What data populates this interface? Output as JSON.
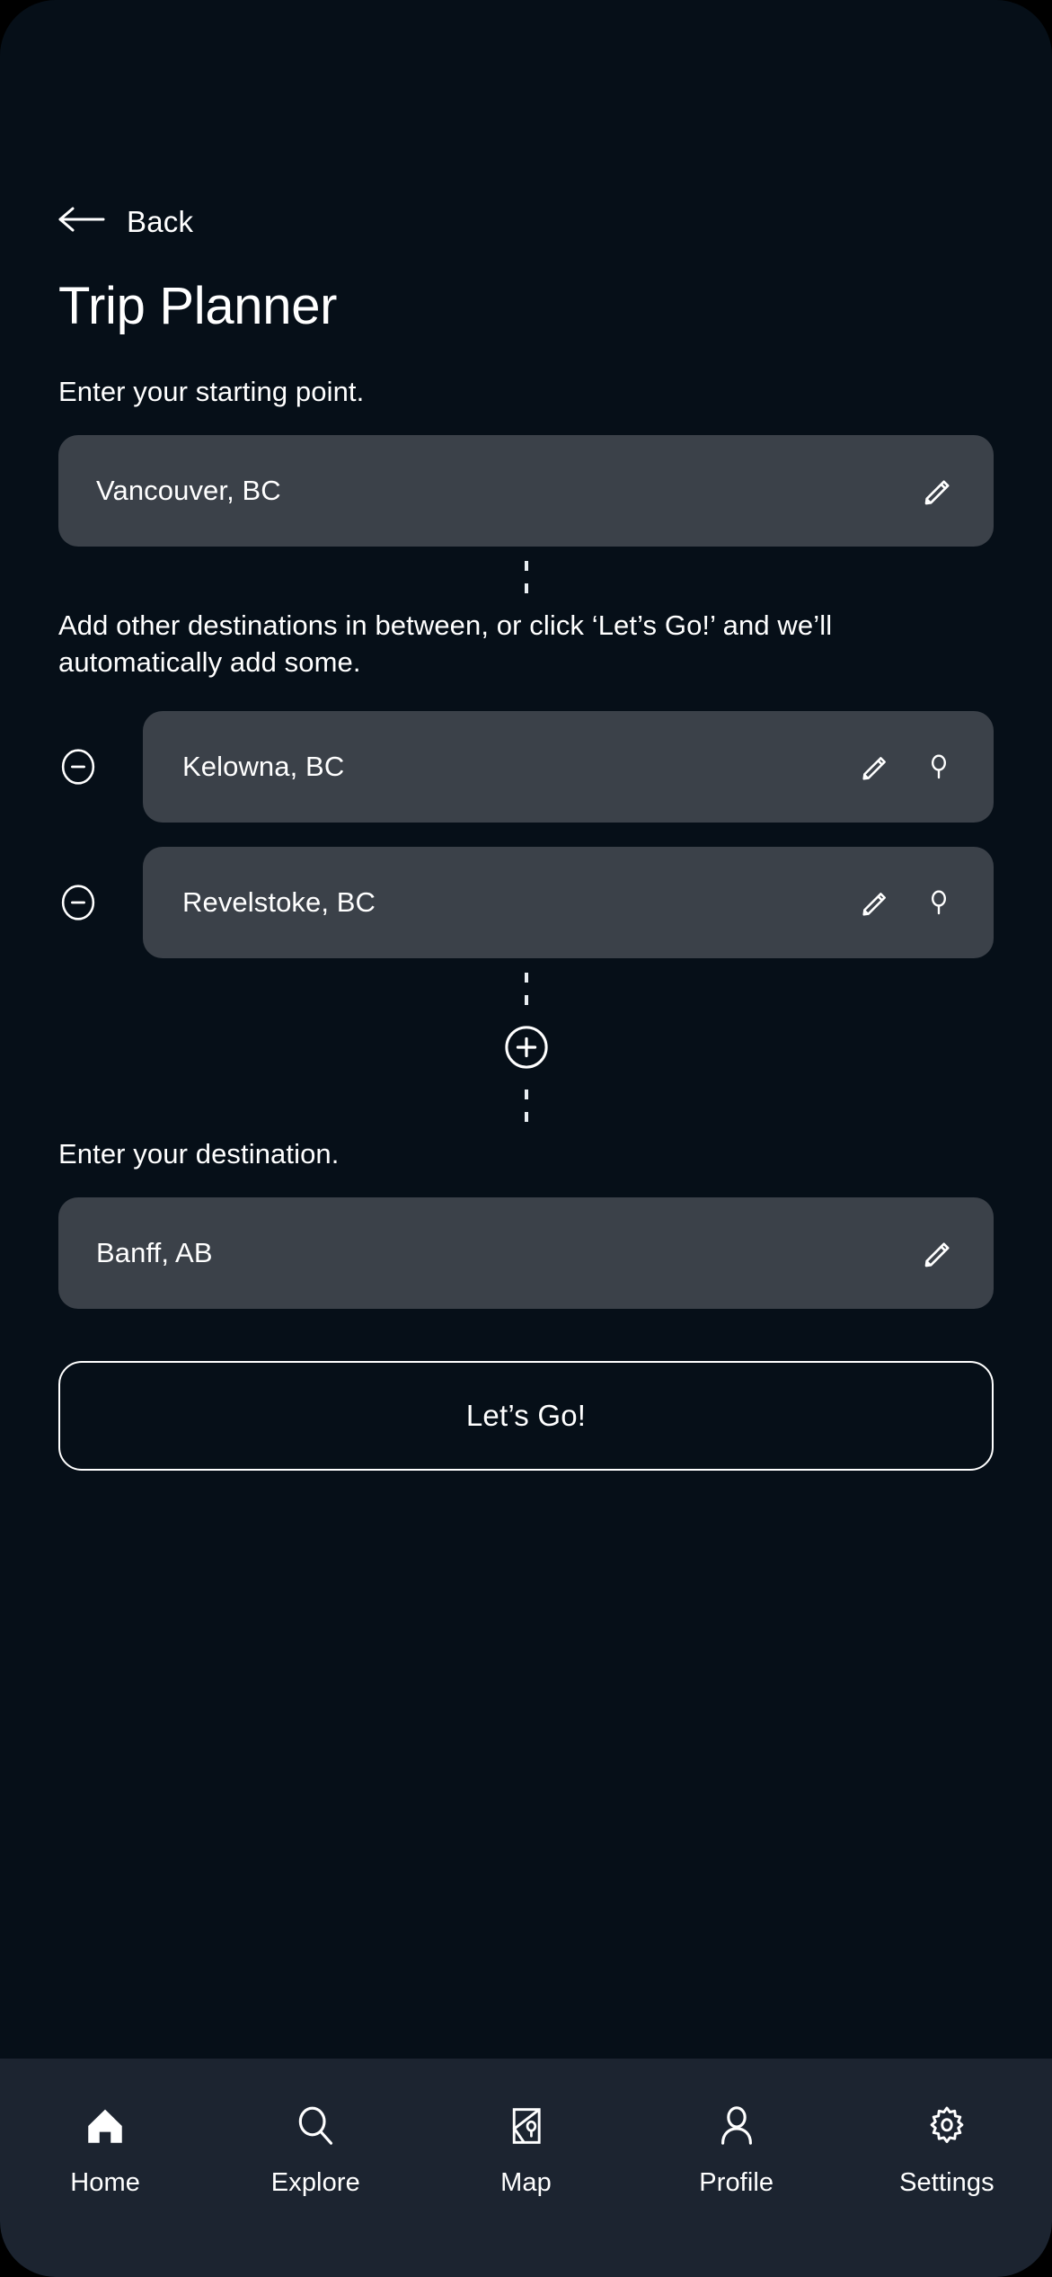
{
  "header": {
    "back_label": "Back",
    "back_icon": "arrow-left-icon",
    "title": "Trip Planner"
  },
  "start_section": {
    "label": "Enter your starting point.",
    "value": "Vancouver, BC",
    "edit_icon": "pencil-icon"
  },
  "middle_section": {
    "label": "Add other destinations in between, or click ‘Let’s Go!’ and we’ll automatically add some.",
    "waypoints": [
      {
        "value": "Kelowna, BC",
        "remove_icon": "minus-circle-icon",
        "edit_icon": "pencil-icon",
        "locate_icon": "map-pin-icon"
      },
      {
        "value": "Revelstoke, BC",
        "remove_icon": "minus-circle-icon",
        "edit_icon": "pencil-icon",
        "locate_icon": "map-pin-icon"
      }
    ],
    "add_icon": "plus-circle-icon"
  },
  "destination_section": {
    "label": "Enter your destination.",
    "value": "Banff, AB",
    "edit_icon": "pencil-icon"
  },
  "primary_action": {
    "label": "Let’s Go!"
  },
  "bottom_nav": {
    "items": [
      {
        "label": "Home",
        "icon": "home-icon",
        "active": true
      },
      {
        "label": "Explore",
        "icon": "search-icon",
        "active": false
      },
      {
        "label": "Map",
        "icon": "map-icon",
        "active": false
      },
      {
        "label": "Profile",
        "icon": "profile-icon",
        "active": false
      },
      {
        "label": "Settings",
        "icon": "gear-icon",
        "active": false
      }
    ]
  },
  "colors": {
    "page_background": "#060f18",
    "field_background": "#3b4149",
    "nav_background": "#1c2430",
    "foreground": "#ffffff"
  }
}
